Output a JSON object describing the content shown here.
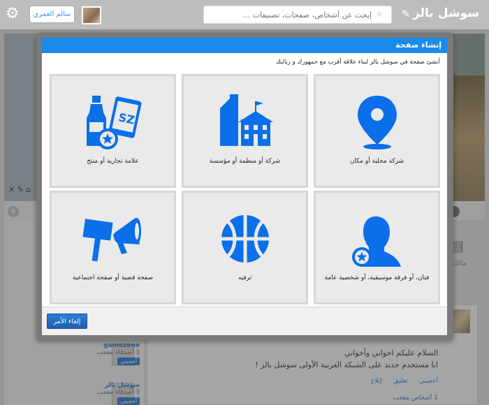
{
  "topbar": {
    "brand": "سوشل بالز",
    "search_placeholder": "إبحث عن أشخاص، صفحات، تصنيفات ...",
    "user_name": "سالم العمري",
    "icons": [
      "compose-icon",
      "search-icon",
      "gear-icon"
    ]
  },
  "background": {
    "post_line1": "السلام عليكم اخواني وأخواتي",
    "post_line2": "انا مستخدم جديد على الشبكة العربية الأولى سوشل بالز !",
    "actions": [
      "أعجبني",
      "تعليق",
      "إبلاغ"
    ],
    "likes": "1 أشخاص معجب",
    "right_label": "مالك",
    "friends": [
      {
        "name": "gamezone",
        "sub1": "3 أصدقاء",
        "sub2": "معجب",
        "button": "أعجبني"
      },
      {
        "name": "سوشل بالز",
        "sub1": "3 أصدقاء",
        "sub2": "معجب",
        "button": "أعجبني"
      }
    ]
  },
  "dialog": {
    "title": "إنشاء صفحة",
    "subtitle": "أنشئ صفحة في سوشل بالز لبناء علاقة أقرب مع جمهورك و زبائنك",
    "accent": "#1a8be8",
    "icon_color": "#0a6fe8",
    "tiles": [
      {
        "label": "شركة محلية أو مكان",
        "icon": "location-pin-icon"
      },
      {
        "label": "شركة أو منظمة أو مؤسسة",
        "icon": "building-icon"
      },
      {
        "label": "علامة تجارية أو منتج",
        "icon": "brand-product-icon"
      },
      {
        "label": "فنان، أو فرقة موسيقية، أو شخصية عامة",
        "icon": "artist-person-icon"
      },
      {
        "label": "ترفيه",
        "icon": "basketball-icon"
      },
      {
        "label": "صفحة قضية أو صفحة اجتماعية",
        "icon": "cause-megaphone-icon"
      }
    ],
    "cancel_label": "إلغاء الأمر"
  }
}
